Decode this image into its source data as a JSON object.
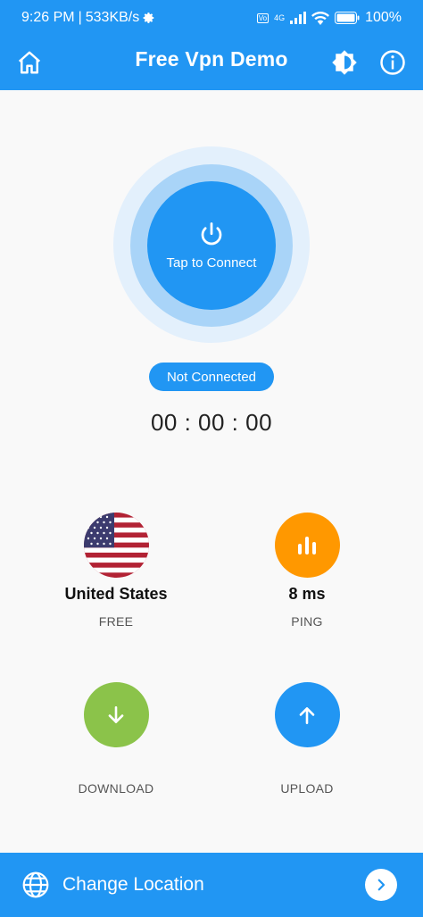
{
  "status_bar": {
    "time": "9:26 PM",
    "speed": "533KB/s",
    "network": "4G",
    "battery": "100%"
  },
  "app_bar": {
    "title": "Free Vpn Demo",
    "icons": [
      "home-icon",
      "brightness-icon",
      "info-icon"
    ]
  },
  "connect": {
    "label": "Tap to Connect",
    "icon": "power-icon"
  },
  "status": {
    "text": "Not Connected",
    "timer": "00 : 00 : 00"
  },
  "stats": {
    "country": {
      "name": "United States",
      "sub": "FREE",
      "icon": "us-flag-icon"
    },
    "ping": {
      "value": "8 ms",
      "sub": "PING",
      "icon": "signal-bars-icon"
    },
    "download": {
      "label": "DOWNLOAD",
      "icon": "arrow-down-icon"
    },
    "upload": {
      "label": "UPLOAD",
      "icon": "arrow-up-icon"
    }
  },
  "footer": {
    "label": "Change Location",
    "icons": [
      "globe-icon",
      "chevron-right-icon"
    ]
  },
  "colors": {
    "primary": "#2196f3",
    "ping": "#ff9800",
    "download": "#8bc34a",
    "upload": "#2196f3",
    "background": "#f9f9f9"
  }
}
